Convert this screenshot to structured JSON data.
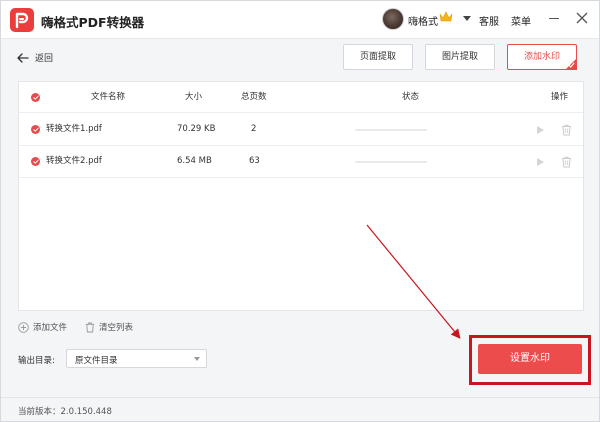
{
  "app": {
    "title": "嗨格式PDF转换器",
    "username": "嗨格式",
    "service": "客服",
    "menu": "菜单"
  },
  "toolbar": {
    "back": "返回",
    "tabs": [
      {
        "label": "页面提取",
        "active": false
      },
      {
        "label": "图片提取",
        "active": false
      },
      {
        "label": "添加水印",
        "active": true
      }
    ]
  },
  "table": {
    "headers": {
      "name": "文件名称",
      "size": "大小",
      "pages": "总页数",
      "status": "状态",
      "actions": "操作"
    },
    "rows": [
      {
        "name": "转换文件1.pdf",
        "size": "70.29 KB",
        "pages": "2",
        "progress": 0
      },
      {
        "name": "转换文件2.pdf",
        "size": "6.54 MB",
        "pages": "63",
        "progress": 0
      }
    ]
  },
  "actions": {
    "add_file": "添加文件",
    "clear_list": "清空列表"
  },
  "output": {
    "label": "输出目录:",
    "value": "原文件目录"
  },
  "primary_button": "设置水印",
  "status": {
    "version": "当前版本：2.0.150.448"
  },
  "colors": {
    "accent": "#ec4c4c",
    "annotation": "#c7161d"
  }
}
